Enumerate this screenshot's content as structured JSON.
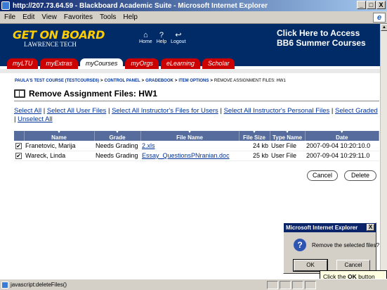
{
  "window": {
    "title": "http://207.73.64.59 - Blackboard Academic Suite - Microsoft Internet Explorer",
    "min": "_",
    "max": "□",
    "close": "X"
  },
  "menu": [
    "File",
    "Edit",
    "View",
    "Favorites",
    "Tools",
    "Help"
  ],
  "banner": {
    "logo": "GET ON BOARD",
    "logo_sub": "LAWRENCE TECH",
    "nav": [
      {
        "icon": "home-icon",
        "glyph": "⌂",
        "label": "Home"
      },
      {
        "icon": "help-icon",
        "glyph": "?",
        "label": "Help"
      },
      {
        "icon": "logout-icon",
        "glyph": "↩",
        "label": "Logout"
      }
    ],
    "promo_line1": "Click Here to Access",
    "promo_line2": "BB6 Summer Courses"
  },
  "tabs": [
    {
      "label": "myLTU",
      "active": false
    },
    {
      "label": "myExtras",
      "active": false
    },
    {
      "label": "myCourses",
      "active": true
    },
    {
      "label": "myOrgs",
      "active": false
    },
    {
      "label": "eLearning",
      "active": false
    },
    {
      "label": "Scholar",
      "active": false
    }
  ],
  "breadcrumb": {
    "items": [
      "PAULA'S TEST COURSE (TESTCOURSE6)",
      "CONTROL PANEL",
      "GRADEBOOK",
      "ITEM OPTIONS"
    ],
    "current": "REMOVE ASSIGNMENT FILES: HW1",
    "separator": ">"
  },
  "page_title": "Remove Assignment Files: HW1",
  "select_links": [
    "Select All",
    "Select All User Files",
    "Select All Instructor's Files for Users",
    "Select All Instructor's Personal Files",
    "Select Graded",
    "Unselect All"
  ],
  "link_separator": "|",
  "table": {
    "caret": "▼",
    "columns": [
      "Name",
      "Grade",
      "File Name",
      "File Size",
      "Type Name",
      "Date"
    ],
    "rows": [
      {
        "checked": "✔",
        "name": "Franetovic, Marija",
        "grade": "Needs Grading",
        "file": "2.xls",
        "size": "24 kb",
        "type": "User File",
        "date": "2007-09-04 10:20:10.0"
      },
      {
        "checked": "✔",
        "name": "Wareck, Linda",
        "grade": "Needs Grading",
        "file": "Essay_QuestionsPNranian.doc",
        "size": "25 kb",
        "type": "User File",
        "date": "2007-09-04 10:29:11.0"
      }
    ]
  },
  "buttons": {
    "cancel": "Cancel",
    "delete": "Delete"
  },
  "dialog": {
    "title": "Microsoft Internet Explorer",
    "close": "X",
    "message": "Remove the selected files?",
    "ok": "OK",
    "cancel": "Cancel",
    "icon_glyph": "?"
  },
  "callout": {
    "prefix": "Click the ",
    "bold": "OK",
    "suffix": " button"
  },
  "status": {
    "text": "javascript:deleteFiles()"
  },
  "colors": {
    "banner": "#002b66",
    "tab": "#cc0000",
    "table_header": "#556c9c",
    "link": "#003399"
  }
}
